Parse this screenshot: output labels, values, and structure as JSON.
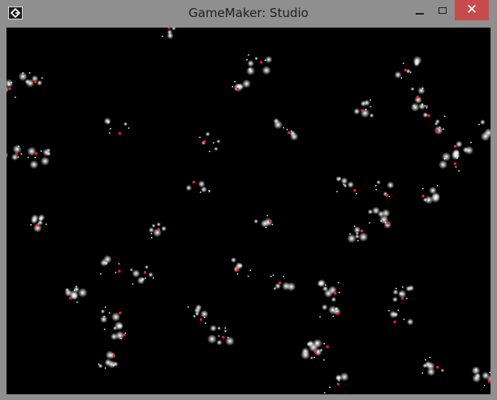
{
  "window": {
    "title": "GameMaker: Studio",
    "close_symbol": "✕"
  },
  "icons": {
    "app": "gamemaker-logo-icon",
    "minimize": "minimize-icon",
    "maximize": "maximize-icon",
    "close": "close-icon"
  },
  "colors": {
    "frame": "#8f8f8f",
    "close_button": "#c74b4b",
    "canvas_background": "#000000",
    "particle": "#ffffff",
    "particle_core": "#ff2020"
  }
}
